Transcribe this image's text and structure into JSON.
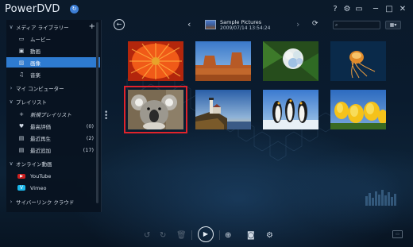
{
  "app": {
    "title": "PowerDVD",
    "badge": "↻"
  },
  "window_controls": {
    "help": "?",
    "settings": "⚙",
    "tv": "▭",
    "minimize": "─",
    "maximize": "□",
    "close": "✕"
  },
  "sidebar": {
    "items": [
      {
        "label": "メディア ライブラリー",
        "chevron": "∨",
        "icon": "",
        "count": ""
      },
      {
        "label": "ムービー",
        "chevron": "",
        "icon": "▭",
        "count": ""
      },
      {
        "label": "動画",
        "chevron": "",
        "icon": "▣",
        "count": ""
      },
      {
        "label": "画像",
        "chevron": "",
        "icon": "▨",
        "count": ""
      },
      {
        "label": "音楽",
        "chevron": "",
        "icon": "♫",
        "count": ""
      },
      {
        "label": "マイ コンピューター",
        "chevron": "›",
        "icon": "",
        "count": ""
      },
      {
        "label": "プレイリスト",
        "chevron": "∨",
        "icon": "",
        "count": ""
      },
      {
        "label": "新規プレイリスト",
        "chevron": "",
        "icon": "+",
        "count": ""
      },
      {
        "label": "最高評価",
        "chevron": "",
        "icon": "♥",
        "count": "(0)"
      },
      {
        "label": "最近再生",
        "chevron": "",
        "icon": "▤",
        "count": "(2)"
      },
      {
        "label": "最近追加",
        "chevron": "",
        "icon": "▤",
        "count": "(17)"
      },
      {
        "label": "オンライン動画",
        "chevron": "∨",
        "icon": "",
        "count": ""
      },
      {
        "label": "YouTube",
        "chevron": "",
        "icon": "▶",
        "count": ""
      },
      {
        "label": "Vimeo",
        "chevron": "",
        "icon": "V",
        "count": ""
      },
      {
        "label": "サイバーリンク クラウド",
        "chevron": "›",
        "icon": "",
        "count": ""
      }
    ],
    "add_label": "+"
  },
  "header": {
    "back_icon": "←",
    "prev_icon": "‹",
    "next_icon": "›",
    "album_name": "Sample Pictures",
    "album_date": "2009/07/14 13:54:24",
    "refresh_icon": "⟳",
    "search_icon": "⌕",
    "search_placeholder": "",
    "view_label": "▦▾"
  },
  "photos": [
    {
      "name": "chrysanthemum",
      "selected": false
    },
    {
      "name": "desert",
      "selected": false
    },
    {
      "name": "hydrangeas",
      "selected": false
    },
    {
      "name": "jellyfish",
      "selected": false
    },
    {
      "name": "koala",
      "selected": true
    },
    {
      "name": "lighthouse",
      "selected": false
    },
    {
      "name": "penguins",
      "selected": false
    },
    {
      "name": "tulips",
      "selected": false
    }
  ],
  "bottombar": {
    "rotate_left": "↺",
    "rotate_right": "↻",
    "delete": "🗑",
    "play": "▶",
    "zoom": "⊕",
    "vr": "◙",
    "settings": "⚙",
    "corner": "▭"
  },
  "colors": {
    "accent": "#2e7bd0",
    "selection": "#e0232b",
    "background": "#0a1b2e"
  }
}
